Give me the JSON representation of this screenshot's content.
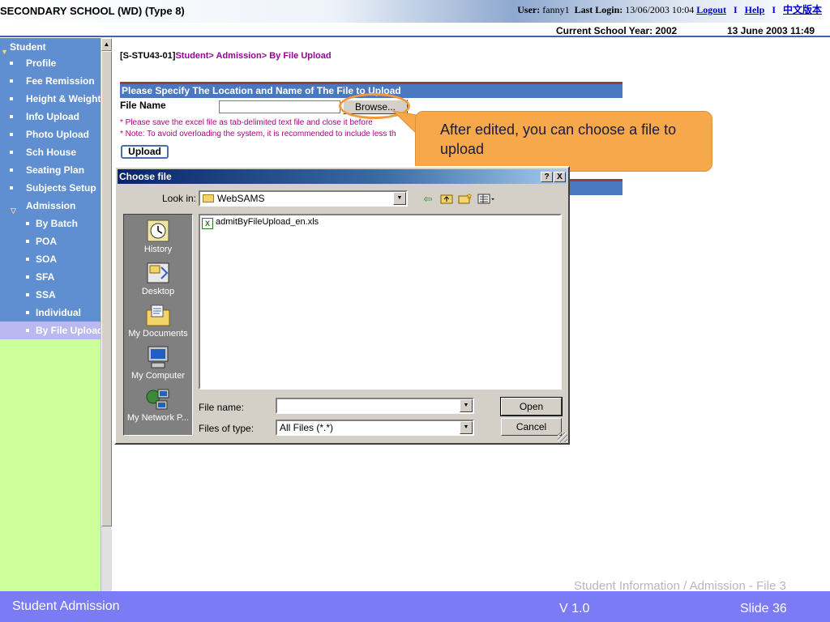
{
  "header": {
    "school_title": "SECONDARY SCHOOL (WD) (Type 8)",
    "user_label": "User:",
    "user_name": "fanny1",
    "last_login_label": "Last Login:",
    "last_login_value": "13/06/2003 10:04",
    "logout": "Logout",
    "separator": "I",
    "help": "Help",
    "chinese": "中文版本",
    "school_year": "Current School Year: 2002",
    "date_time": "13 June 2003 11:49"
  },
  "sidebar": {
    "items": [
      {
        "label": "Student"
      },
      {
        "label": "Profile"
      },
      {
        "label": "Fee Remission"
      },
      {
        "label": "Height & Weight"
      },
      {
        "label": "Info Upload"
      },
      {
        "label": "Photo Upload"
      },
      {
        "label": "Sch House"
      },
      {
        "label": "Seating Plan"
      },
      {
        "label": "Subjects Setup"
      },
      {
        "label": "Admission"
      },
      {
        "label": "By Batch"
      },
      {
        "label": "POA"
      },
      {
        "label": "SOA"
      },
      {
        "label": "SFA"
      },
      {
        "label": "SSA"
      },
      {
        "label": "Individual"
      },
      {
        "label": "By File Upload"
      }
    ]
  },
  "page": {
    "code": "[S-STU43-01]",
    "crumb1": "Student",
    "crumb2": "> Admission",
    "crumb3": "> By File Upload",
    "form_header": "Please Specify The Location and Name of The File to Upload",
    "file_name_label": "File Name",
    "browse_label": "Browse...",
    "note1": "* Please save the excel file as tab-delimited text file and close it before",
    "note2": "* Note: To avoid overloading the system, it is recommended to include less th",
    "upload_label": "Upload"
  },
  "callout": {
    "text": "After edited, you can choose a file to upload"
  },
  "dialog": {
    "title": "Choose file",
    "help_btn": "?",
    "close_btn": "X",
    "look_in_label": "Look in:",
    "look_in_value": "WebSAMS",
    "places": [
      {
        "label": "History",
        "icon": "history-icon"
      },
      {
        "label": "Desktop",
        "icon": "desktop-icon"
      },
      {
        "label": "My Documents",
        "icon": "my-documents-icon"
      },
      {
        "label": "My Computer",
        "icon": "my-computer-icon"
      },
      {
        "label": "My Network P...",
        "icon": "my-network-places-icon"
      }
    ],
    "files": [
      {
        "name": "admitByFileUpload_en.xls",
        "icon": "excel-file-icon"
      }
    ],
    "file_name_label": "File name:",
    "file_name_value": "",
    "file_type_label": "Files of type:",
    "file_type_value": "All Files (*.*)",
    "open_label": "Open",
    "cancel_label": "Cancel"
  },
  "footer": {
    "caption": "Student Information / Admission - File 3",
    "left": "Student Admission",
    "version": "V 1.0",
    "slide": "Slide 36"
  },
  "colors": {
    "sidebar_bg": "#5f8fd1",
    "sidebar_active": "#b9b9f0",
    "sidebar_fill": "#ccff99",
    "form_header": "#4a78c0",
    "callout": "#f7a84a",
    "footer": "#7b7bf5",
    "crumb": "#990099"
  }
}
